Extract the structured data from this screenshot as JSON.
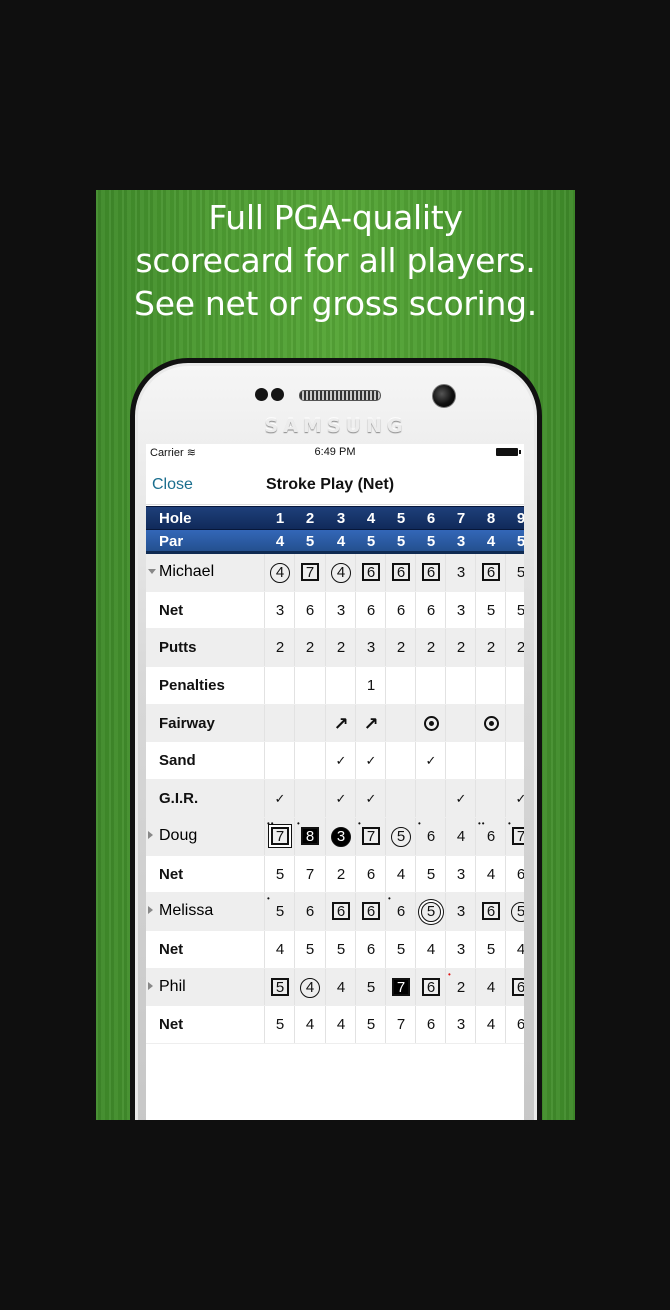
{
  "headline": [
    "Full PGA-quality",
    "scorecard for all players.",
    "See net or gross scoring."
  ],
  "device": {
    "brand": "SAMSUNG"
  },
  "status": {
    "carrier": "Carrier",
    "time": "6:49 PM"
  },
  "nav": {
    "close": "Close",
    "title": "Stroke Play (Net)"
  },
  "holes": {
    "label": "Hole",
    "values": [
      "1",
      "2",
      "3",
      "4",
      "5",
      "6",
      "7",
      "8",
      "9"
    ]
  },
  "par": {
    "label": "Par",
    "values": [
      "4",
      "5",
      "4",
      "5",
      "5",
      "5",
      "3",
      "4",
      "5"
    ]
  },
  "rows": [
    {
      "type": "player",
      "label": "Michael",
      "expanded": true,
      "alt": true,
      "cells": [
        {
          "v": "4",
          "s": "ci"
        },
        {
          "v": "7",
          "s": "sq"
        },
        {
          "v": "4",
          "s": "ci"
        },
        {
          "v": "6",
          "s": "sq"
        },
        {
          "v": "6",
          "s": "sq"
        },
        {
          "v": "6",
          "s": "sq"
        },
        {
          "v": "3"
        },
        {
          "v": "6",
          "s": "sq"
        },
        {
          "v": "5"
        }
      ]
    },
    {
      "type": "stat",
      "label": "Net",
      "cells": [
        {
          "v": "3"
        },
        {
          "v": "6"
        },
        {
          "v": "3"
        },
        {
          "v": "6"
        },
        {
          "v": "6"
        },
        {
          "v": "6"
        },
        {
          "v": "3"
        },
        {
          "v": "5"
        },
        {
          "v": "5"
        }
      ]
    },
    {
      "type": "stat",
      "label": "Putts",
      "alt": true,
      "cells": [
        {
          "v": "2"
        },
        {
          "v": "2"
        },
        {
          "v": "2"
        },
        {
          "v": "3"
        },
        {
          "v": "2"
        },
        {
          "v": "2"
        },
        {
          "v": "2"
        },
        {
          "v": "2"
        },
        {
          "v": "2"
        }
      ]
    },
    {
      "type": "stat",
      "label": "Penalties",
      "cells": [
        {
          "v": ""
        },
        {
          "v": ""
        },
        {
          "v": ""
        },
        {
          "v": "1"
        },
        {
          "v": ""
        },
        {
          "v": ""
        },
        {
          "v": ""
        },
        {
          "v": ""
        },
        {
          "v": ""
        }
      ]
    },
    {
      "type": "stat",
      "label": "Fairway",
      "alt": true,
      "cells": [
        {
          "v": ""
        },
        {
          "v": ""
        },
        {
          "v": "↗",
          "s": "arrow"
        },
        {
          "v": "↗",
          "s": "arrow"
        },
        {
          "v": ""
        },
        {
          "v": "",
          "s": "target"
        },
        {
          "v": ""
        },
        {
          "v": "",
          "s": "target"
        },
        {
          "v": ""
        }
      ]
    },
    {
      "type": "stat",
      "label": "Sand",
      "cells": [
        {
          "v": ""
        },
        {
          "v": ""
        },
        {
          "v": "✓",
          "s": "chk"
        },
        {
          "v": "✓",
          "s": "chk"
        },
        {
          "v": ""
        },
        {
          "v": "✓",
          "s": "chk"
        },
        {
          "v": ""
        },
        {
          "v": ""
        },
        {
          "v": ""
        }
      ]
    },
    {
      "type": "stat",
      "label": "G.I.R.",
      "alt": true,
      "cells": [
        {
          "v": "✓",
          "s": "chk"
        },
        {
          "v": ""
        },
        {
          "v": "✓",
          "s": "chk"
        },
        {
          "v": "✓",
          "s": "chk"
        },
        {
          "v": ""
        },
        {
          "v": ""
        },
        {
          "v": "✓",
          "s": "chk"
        },
        {
          "v": ""
        },
        {
          "v": "✓",
          "s": "chk"
        }
      ]
    },
    {
      "type": "player",
      "label": "Doug",
      "expanded": false,
      "alt": true,
      "cells": [
        {
          "v": "7",
          "s": "sq dbl",
          "d": "••"
        },
        {
          "v": "8",
          "s": "sq fill",
          "d": "•"
        },
        {
          "v": "3",
          "s": "ci fill"
        },
        {
          "v": "7",
          "s": "sq",
          "d": "•"
        },
        {
          "v": "5",
          "s": "ci"
        },
        {
          "v": "6",
          "d": "•"
        },
        {
          "v": "4"
        },
        {
          "v": "6",
          "d": "••"
        },
        {
          "v": "7",
          "s": "sq",
          "d": "•"
        }
      ]
    },
    {
      "type": "stat",
      "label": "Net",
      "cells": [
        {
          "v": "5"
        },
        {
          "v": "7"
        },
        {
          "v": "2"
        },
        {
          "v": "6"
        },
        {
          "v": "4"
        },
        {
          "v": "5"
        },
        {
          "v": "3"
        },
        {
          "v": "4"
        },
        {
          "v": "6"
        }
      ]
    },
    {
      "type": "player",
      "label": "Melissa",
      "expanded": false,
      "alt": true,
      "cells": [
        {
          "v": "5",
          "d": "•"
        },
        {
          "v": "6"
        },
        {
          "v": "6",
          "s": "sq"
        },
        {
          "v": "6",
          "s": "sq"
        },
        {
          "v": "6",
          "d": "•"
        },
        {
          "v": "5",
          "s": "ci dbl"
        },
        {
          "v": "3"
        },
        {
          "v": "6",
          "s": "sq"
        },
        {
          "v": "5",
          "s": "ci"
        }
      ]
    },
    {
      "type": "stat",
      "label": "Net",
      "cells": [
        {
          "v": "4"
        },
        {
          "v": "5"
        },
        {
          "v": "5"
        },
        {
          "v": "6"
        },
        {
          "v": "5"
        },
        {
          "v": "4"
        },
        {
          "v": "3"
        },
        {
          "v": "5"
        },
        {
          "v": "4"
        }
      ]
    },
    {
      "type": "player",
      "label": "Phil",
      "expanded": false,
      "alt": true,
      "cells": [
        {
          "v": "5",
          "s": "sq"
        },
        {
          "v": "4",
          "s": "ci"
        },
        {
          "v": "4"
        },
        {
          "v": "5"
        },
        {
          "v": "7",
          "s": "sq fill"
        },
        {
          "v": "6",
          "s": "sq"
        },
        {
          "v": "2",
          "d": "•",
          "dc": "red"
        },
        {
          "v": "4"
        },
        {
          "v": "6",
          "s": "sq"
        }
      ]
    },
    {
      "type": "stat",
      "label": "Net",
      "cells": [
        {
          "v": "5"
        },
        {
          "v": "4"
        },
        {
          "v": "4"
        },
        {
          "v": "5"
        },
        {
          "v": "7"
        },
        {
          "v": "6"
        },
        {
          "v": "3"
        },
        {
          "v": "4"
        },
        {
          "v": "6"
        }
      ]
    }
  ]
}
